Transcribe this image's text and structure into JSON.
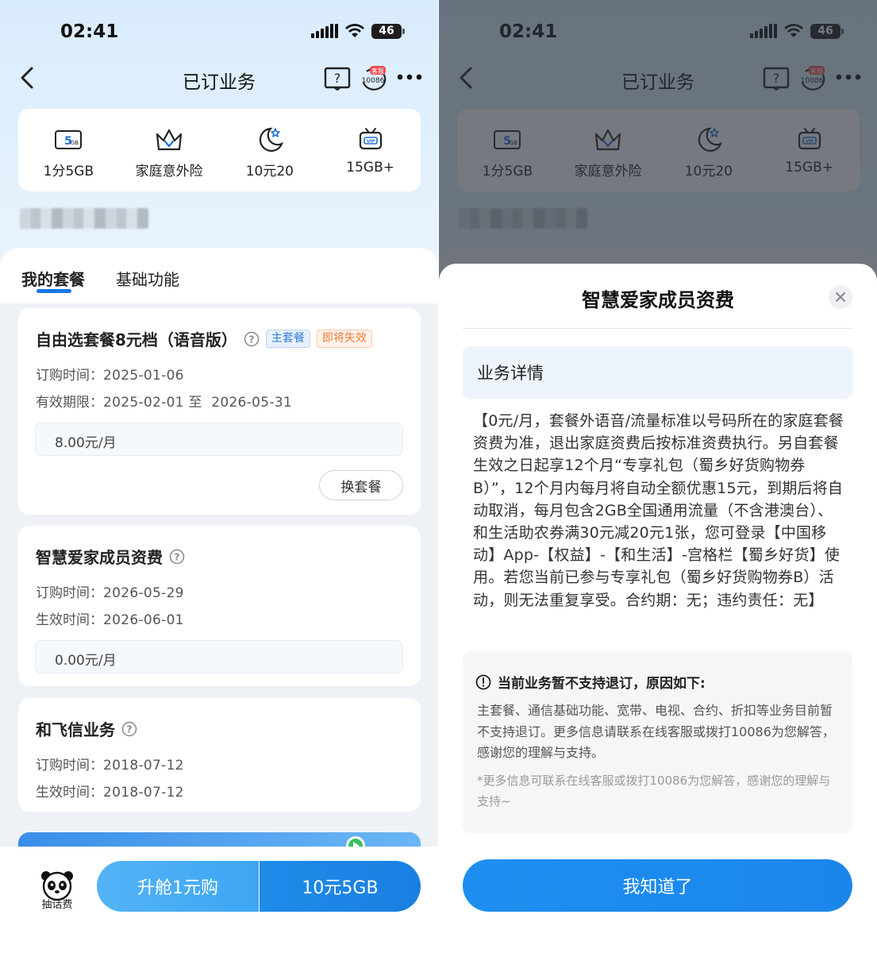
{
  "status_bar": {
    "time": "02:41",
    "battery": "46"
  },
  "nav": {
    "title": "已订业务",
    "cs_badge": "客服",
    "cs_number": "10086"
  },
  "quick_items": [
    {
      "icon": "5gb-icon",
      "label": "1分5GB"
    },
    {
      "icon": "crown-icon",
      "label": "家庭意外险"
    },
    {
      "icon": "moon-star-icon",
      "label": "10元20"
    },
    {
      "icon": "vip-tv-icon",
      "label": "15GB+"
    }
  ],
  "tabs": [
    {
      "label": "我的套餐",
      "active": true
    },
    {
      "label": "基础功能",
      "active": false
    }
  ],
  "packages": [
    {
      "title": "自由选套餐8元档（语音版）",
      "badges": [
        "主套餐",
        "即将失效"
      ],
      "rows": [
        {
          "key": "订购时间：",
          "value": "2025-01-06"
        },
        {
          "key": "有效期限：",
          "value": "2025-02-01 至  2026-05-31"
        }
      ],
      "price": "8.00元/月",
      "action": "换套餐"
    },
    {
      "title": "智慧爱家成员资费",
      "rows": [
        {
          "key": "订购时间：",
          "value": "2026-05-29"
        },
        {
          "key": "生效时间：",
          "value": "2026-06-01"
        }
      ],
      "price": "0.00元/月"
    },
    {
      "title": "和飞信业务",
      "rows": [
        {
          "key": "订购时间：",
          "value": "2018-07-12"
        },
        {
          "key": "生效时间：",
          "value": "2018-07-12"
        }
      ]
    }
  ],
  "bottom_bar": {
    "panda_label": "抽话费",
    "cta_left": "升舱1元购",
    "cta_right": "10元5GB"
  },
  "modal": {
    "title": "智慧爱家成员资费",
    "section_title": "业务详情",
    "detail": "【0元/月，套餐外语音/流量标准以号码所在的家庭套餐资费为准，退出家庭资费后按标准资费执行。另自套餐生效之日起享12个月“专享礼包（蜀乡好货购物券B）”，12个月内每月将自动全额优惠15元，到期后将自动取消，每月包含2GB全国通用流量（不含港澳台）、和生活助农券满30元减20元1张，您可登录【中国移动】App-【权益】-【和生活】-宫格栏【蜀乡好货】使用。若您当前已参与专享礼包（蜀乡好货购物券B）活动，则无法重复享受。合约期：无；违约责任：无】",
    "notice_title": "当前业务暂不支持退订，原因如下:",
    "notice_body": "主套餐、通信基础功能、宽带、电视、合约、折扣等业务目前暂不支持退订。更多信息请联系在线客服或拨打10086为您解答，感谢您的理解与支持。",
    "notice_foot": "*更多信息可联系在线客服或拨打10086为您解答，感谢您的理解与支持~",
    "ok_button": "我知道了"
  },
  "colors": {
    "accent": "#1976e6",
    "badge_main": "#2f7bd8",
    "badge_warn": "#f07a3c"
  }
}
